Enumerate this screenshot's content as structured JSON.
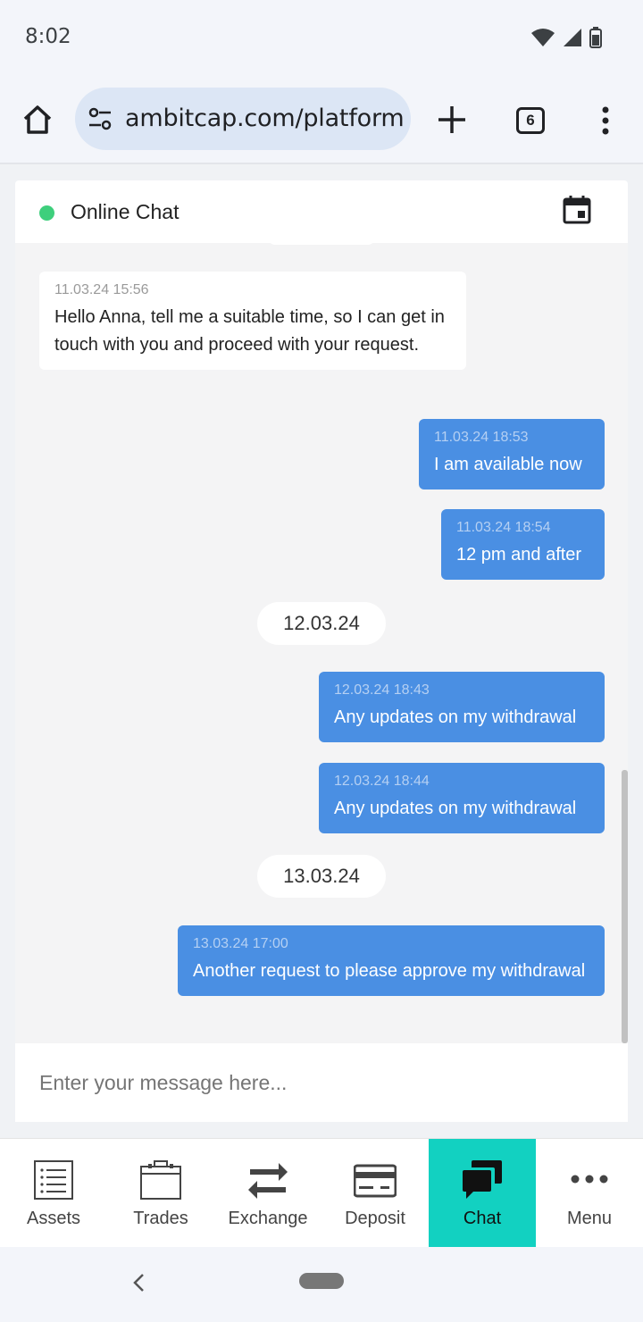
{
  "status_bar": {
    "time": "8:02"
  },
  "browser": {
    "url": "ambitcap.com/platform.l",
    "tab_count": "6"
  },
  "chat": {
    "title": "Online Chat",
    "input_placeholder": "Enter your message here...",
    "messages": [
      {
        "direction": "in",
        "timestamp": "11.03.24 15:56",
        "text": "Hello Anna, tell me a suitable time, so I can get in touch with you and proceed with your request."
      },
      {
        "direction": "out",
        "timestamp": "11.03.24 18:53",
        "text": "I am available now"
      },
      {
        "direction": "out",
        "timestamp": "11.03.24 18:54",
        "text": "12 pm and after"
      },
      {
        "direction": "out",
        "timestamp": "12.03.24 18:43",
        "text": "Any updates on my withdrawal"
      },
      {
        "direction": "out",
        "timestamp": "12.03.24 18:44",
        "text": "Any updates on my withdrawal"
      },
      {
        "direction": "out",
        "timestamp": "13.03.24 17:00",
        "text": "Another request to please approve my withdrawal"
      }
    ],
    "date_separators": [
      "12.03.24",
      "13.03.24"
    ]
  },
  "bottom_nav": {
    "items": [
      {
        "label": "Assets",
        "icon": "list-icon",
        "active": false
      },
      {
        "label": "Trades",
        "icon": "briefcase-icon",
        "active": false
      },
      {
        "label": "Exchange",
        "icon": "exchange-arrows-icon",
        "active": false
      },
      {
        "label": "Deposit",
        "icon": "credit-card-icon",
        "active": false
      },
      {
        "label": "Chat",
        "icon": "chat-bubbles-icon",
        "active": true
      },
      {
        "label": "Menu",
        "icon": "more-dots-icon",
        "active": false
      }
    ]
  },
  "colors": {
    "accent_active_tab": "#12d1c1",
    "outgoing_bubble": "#4a8fe3",
    "online_indicator": "#3ecf7c"
  }
}
